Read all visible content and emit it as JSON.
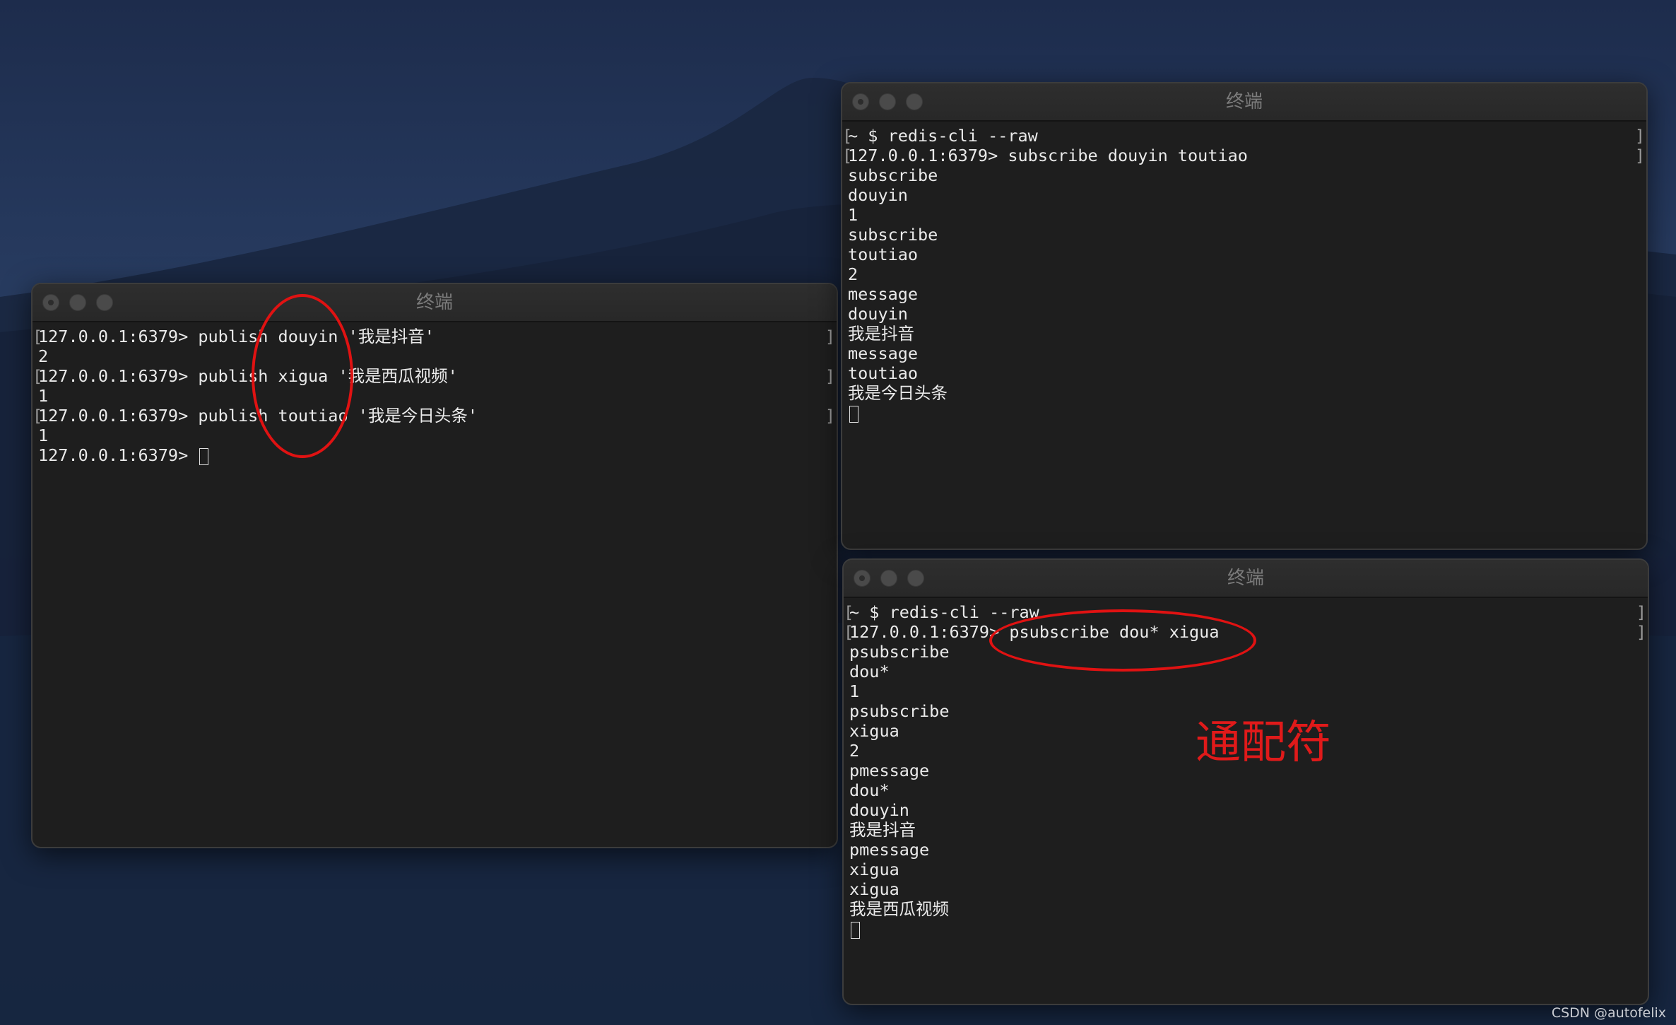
{
  "window_title": "终端",
  "publisher": {
    "lines": [
      {
        "text": "127.0.0.1:6379> publish douyin '我是抖音'",
        "bracket": true
      },
      {
        "text": "2",
        "bracket": false
      },
      {
        "text": "127.0.0.1:6379> publish xigua '我是西瓜视频'",
        "bracket": true
      },
      {
        "text": "1",
        "bracket": false
      },
      {
        "text": "127.0.0.1:6379> publish toutiao '我是今日头条'",
        "bracket": true
      },
      {
        "text": "1",
        "bracket": false
      },
      {
        "text": "127.0.0.1:6379> ",
        "bracket": false,
        "cursor": true
      }
    ]
  },
  "subscriber": {
    "lines": [
      {
        "text": "~ $ redis-cli --raw",
        "bracket": true
      },
      {
        "text": "127.0.0.1:6379> subscribe douyin toutiao",
        "bracket": true
      },
      {
        "text": "subscribe"
      },
      {
        "text": "douyin"
      },
      {
        "text": "1"
      },
      {
        "text": "subscribe"
      },
      {
        "text": "toutiao"
      },
      {
        "text": "2"
      },
      {
        "text": "message"
      },
      {
        "text": "douyin"
      },
      {
        "text": "我是抖音"
      },
      {
        "text": "message"
      },
      {
        "text": "toutiao"
      },
      {
        "text": "我是今日头条"
      },
      {
        "text": "",
        "cursor": true
      }
    ]
  },
  "psubscriber": {
    "lines": [
      {
        "text": "~ $ redis-cli --raw",
        "bracket": true
      },
      {
        "text": "127.0.0.1:6379> psubscribe dou* xigua",
        "bracket": true
      },
      {
        "text": "psubscribe"
      },
      {
        "text": "dou*"
      },
      {
        "text": "1"
      },
      {
        "text": "psubscribe"
      },
      {
        "text": "xigua"
      },
      {
        "text": "2"
      },
      {
        "text": "pmessage"
      },
      {
        "text": "dou*"
      },
      {
        "text": "douyin"
      },
      {
        "text": "我是抖音"
      },
      {
        "text": "pmessage"
      },
      {
        "text": "xigua"
      },
      {
        "text": "xigua"
      },
      {
        "text": "我是西瓜视频"
      },
      {
        "text": "",
        "cursor": true
      }
    ]
  },
  "annotation_label": "通配符",
  "watermark": "CSDN @autofelix",
  "colors": {
    "annotation": "#e01212",
    "terminal_bg": "#1e1e1e",
    "terminal_text": "#eaeaea"
  }
}
